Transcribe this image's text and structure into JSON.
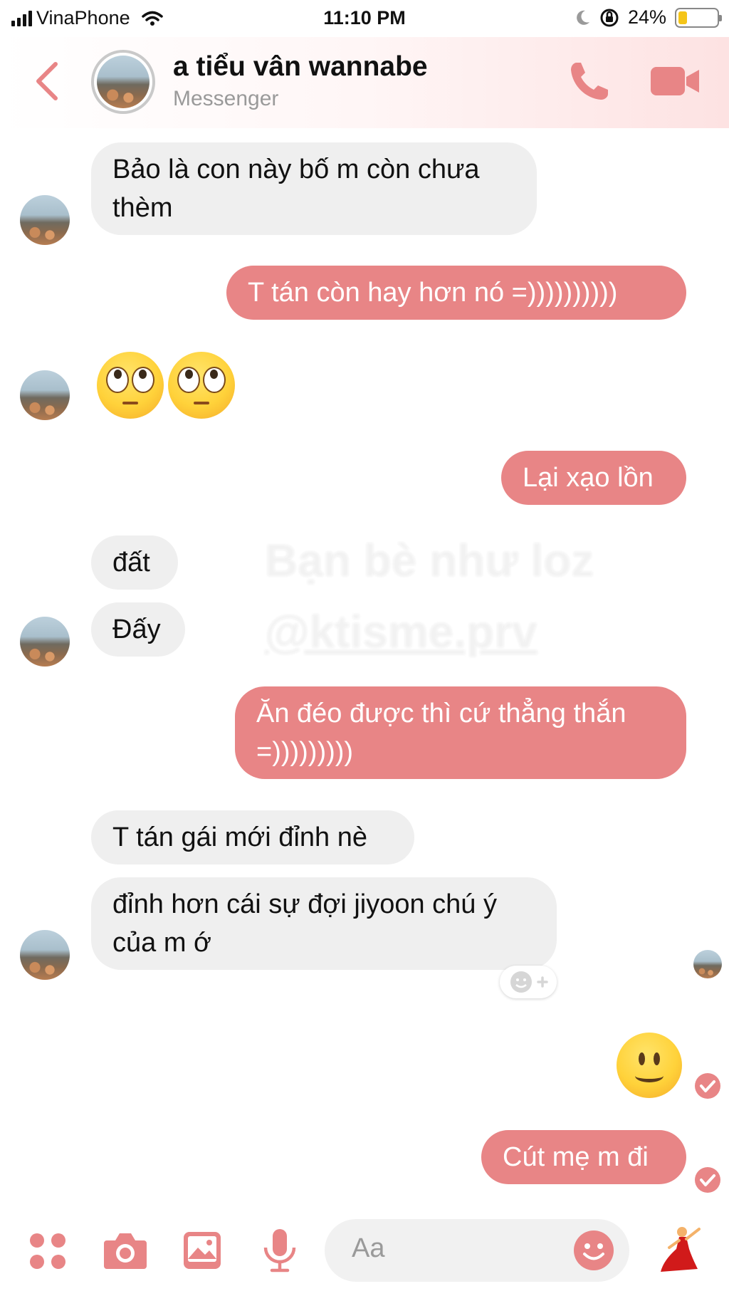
{
  "status_bar": {
    "carrier": "VinaPhone",
    "time": "11:10 PM",
    "battery": "24%",
    "battery_level": 0.24
  },
  "header": {
    "name": "a tiểu vân wannabe",
    "subtitle": "Messenger",
    "icons": [
      "back-icon",
      "call-icon",
      "video-call-icon"
    ]
  },
  "messages": [
    {
      "side": "in",
      "text": "Bảo là con này bố m còn chưa thèm"
    },
    {
      "side": "out",
      "text": "T tán còn hay hơn nó =))))))))))"
    },
    {
      "side": "in",
      "emoji": "🙄🙄"
    },
    {
      "side": "out",
      "text": "Lại xạo lồn"
    },
    {
      "side": "in",
      "text": "đất"
    },
    {
      "side": "in",
      "text": "Đấy"
    },
    {
      "side": "out",
      "text": "Ăn đéo được thì cứ thẳng thắn =)))))))))"
    },
    {
      "side": "in",
      "text": "T tán gái mới đỉnh nè"
    },
    {
      "side": "in",
      "text": "đỉnh hơn cái sự đợi jiyoon chú ý của m ớ"
    },
    {
      "side": "out",
      "emoji": "🙂"
    },
    {
      "side": "out",
      "text": "Cút mẹ m đi"
    }
  ],
  "watermark": {
    "line1": "Bạn bè như loz",
    "line2": "@ktisme.prv"
  },
  "composer": {
    "placeholder": "Aa",
    "icons": [
      "apps-icon",
      "camera-icon",
      "image-icon",
      "microphone-icon",
      "emoji-icon",
      "dancer-sticker-icon"
    ]
  },
  "colors": {
    "accent": "#e88586",
    "incoming_bubble": "#efefef",
    "outgoing_bubble": "#e88586"
  }
}
